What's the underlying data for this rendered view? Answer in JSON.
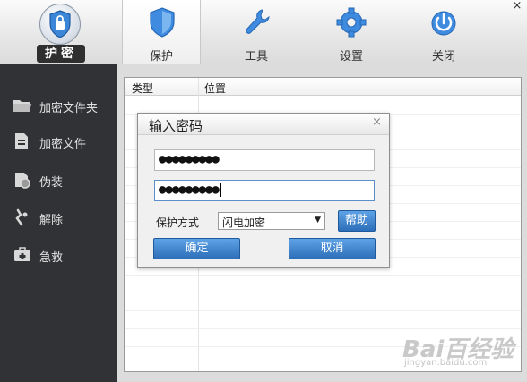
{
  "app": {
    "logo_label": "护密"
  },
  "toolbar": {
    "tabs": [
      {
        "label": "保护",
        "icon": "shield-icon"
      },
      {
        "label": "工具",
        "icon": "wrench-icon"
      },
      {
        "label": "设置",
        "icon": "gear-icon"
      },
      {
        "label": "关闭",
        "icon": "power-icon"
      }
    ],
    "active_tab": "保护",
    "close_glyph": "×"
  },
  "sidebar": {
    "items": [
      {
        "label": "加密文件夹",
        "icon": "folder-icon"
      },
      {
        "label": "加密文件",
        "icon": "file-icon"
      },
      {
        "label": "伪装",
        "icon": "disguise-icon"
      },
      {
        "label": "解除",
        "icon": "unlock-icon"
      },
      {
        "label": "急救",
        "icon": "first-aid-icon"
      }
    ]
  },
  "table": {
    "columns": [
      "类型",
      "位置"
    ],
    "rows": []
  },
  "dialog": {
    "title": "输入密码",
    "close_glyph": "×",
    "password": "●●●●●●●●●",
    "confirm_password": "●●●●●●●●●",
    "mode_label": "保护方式",
    "mode_value": "闪电加密",
    "help_label": "帮助",
    "ok_label": "确定",
    "cancel_label": "取消"
  },
  "watermark": {
    "text": "Bai百经验",
    "sub": "jingyan.baidu.com"
  },
  "colors": {
    "sidebar_bg": "#303235",
    "button_blue": "#2d6fb9",
    "accent_blue": "#3f8be0"
  }
}
